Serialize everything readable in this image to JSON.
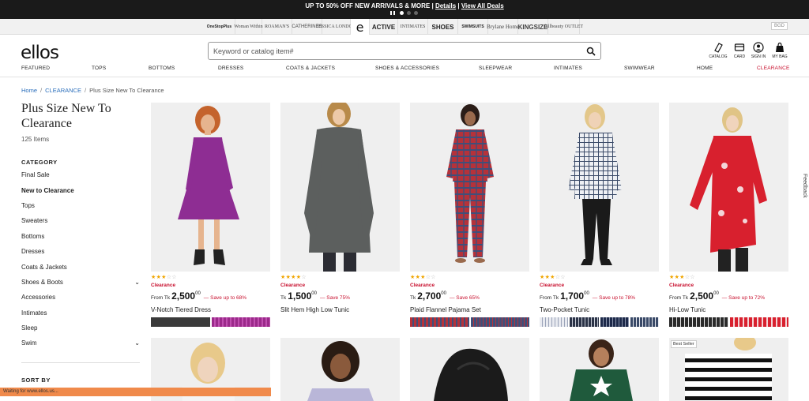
{
  "promo": {
    "message": "UP TO 50% OFF NEW ARRIVALS & MORE | ",
    "details": "Details",
    "sep": " | ",
    "view_all": "View All Deals"
  },
  "brands": [
    "OneStopPlus",
    "Woman Within",
    "ROAMAN'S",
    "CATHERINES",
    "JESSICA LONDON",
    "e",
    "ACTIVE",
    "INTIMATES",
    "SHOES",
    "SWIMSUITS",
    "Brylane Home",
    "KINGSIZE",
    "fullbeauty OUTLET"
  ],
  "currency": "BGD",
  "logo": "ellos",
  "search": {
    "placeholder": "Keyword or catalog item#"
  },
  "utility": {
    "catalog": "CATALOG",
    "card": "CARD",
    "signin": "SIGN IN",
    "bag": "MY BAG"
  },
  "nav": [
    "FEATURED",
    "TOPS",
    "BOTTOMS",
    "DRESSES",
    "COATS & JACKETS",
    "SHOES & ACCESSORIES",
    "SLEEPWEAR",
    "INTIMATES",
    "SWIMWEAR",
    "HOME",
    "CLEARANCE"
  ],
  "breadcrumb": {
    "home": "Home",
    "clearance": "CLEARANCE",
    "current": "Plus Size New To Clearance"
  },
  "page": {
    "title": "Plus Size New To Clearance",
    "count": "125 Items"
  },
  "filters": {
    "category_heading": "CATEGORY",
    "categories": [
      "Final Sale",
      "New to Clearance",
      "Tops",
      "Sweaters",
      "Bottoms",
      "Dresses",
      "Coats & Jackets",
      "Shoes & Boots",
      "Accessories",
      "Intimates",
      "Sleep",
      "Swim"
    ],
    "sort_heading": "SORT BY"
  },
  "feedback": "Feedback",
  "products": [
    {
      "rating": 3.5,
      "badge": "Clearance",
      "from": "From Tk",
      "amount": "2,500",
      "cents": "00",
      "save": "— Save up to 68%",
      "name": "V-Notch Tiered Dress",
      "colors": [
        "#3a3a3a",
        "#9b2a8a"
      ]
    },
    {
      "rating": 4,
      "badge": "Clearance",
      "from": "Tk",
      "amount": "1,500",
      "cents": "00",
      "save": "— Save 75%",
      "name": "Slit Hem High Low Tunic",
      "colors": []
    },
    {
      "rating": 3.5,
      "badge": "Clearance",
      "from": "Tk",
      "amount": "2,700",
      "cents": "00",
      "save": "— Save 65%",
      "name": "Plaid Flannel Pajama Set",
      "colors": [
        "#b5323a",
        "#3f4f7a"
      ]
    },
    {
      "rating": 3.5,
      "badge": "Clearance",
      "from": "From Tk",
      "amount": "1,700",
      "cents": "00",
      "save": "— Save up to 78%",
      "name": "Two-Pocket Tunic",
      "colors": [
        "#e8eaf0",
        "#2b3347",
        "#1e2a4a",
        "#3a4a68"
      ]
    },
    {
      "rating": 3.5,
      "badge": "Clearance",
      "from": "From Tk",
      "amount": "2,500",
      "cents": "00",
      "save": "— Save up to 72%",
      "name": "Hi-Low Tunic",
      "colors": [
        "#2a2a2a",
        "#d8202e"
      ]
    }
  ],
  "second_row": {
    "badge": "Best Seller"
  },
  "status": "Waiting for www.ellos.us..."
}
